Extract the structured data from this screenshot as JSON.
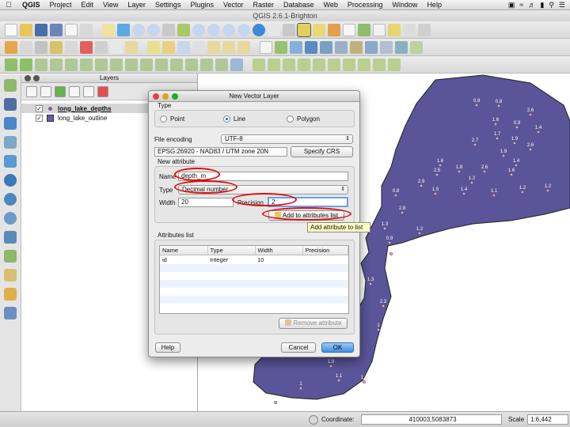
{
  "menubar": {
    "app": "QGIS",
    "items": [
      "Project",
      "Edit",
      "View",
      "Layer",
      "Settings",
      "Plugins",
      "Vector",
      "Raster",
      "Database",
      "Web",
      "Processing",
      "Window",
      "Help"
    ]
  },
  "window_title": "QGIS 2.6.1-Brighton",
  "layers_panel": {
    "title": "Layers",
    "layers": [
      {
        "name": "long_lake_depths",
        "checked": true,
        "bold": true,
        "symbol_color": "#7a5fb0"
      },
      {
        "name": "long_lake_outline",
        "checked": true,
        "bold": false,
        "symbol_color": "#6a5aa8"
      }
    ]
  },
  "map": {
    "lake_color": "#5a5598",
    "depth_labels": [
      "0.9",
      "0.8",
      "2.6",
      "1.6",
      "0.9",
      "1.4",
      "1.7",
      "1.9",
      "2.6",
      "2.7",
      "1.9",
      "1.4",
      "1.6",
      "1.8",
      "2.6",
      "1.6",
      "2.5",
      "1.2",
      "2.9",
      "1.5",
      "1.4",
      "1.1",
      "1.2",
      "1.2",
      "0.8",
      "2.8",
      "1.3",
      "1.2",
      "0.9",
      "2.6",
      "1.3",
      "2.3",
      "1",
      "1.9",
      "1.1",
      "1.1",
      "1",
      "0.9"
    ]
  },
  "dialog": {
    "title": "New Vector Layer",
    "type_group": "Type",
    "type_options": [
      {
        "label": "Point",
        "selected": false
      },
      {
        "label": "Line",
        "selected": true
      },
      {
        "label": "Polygon",
        "selected": false
      }
    ],
    "file_encoding_label": "File encoding",
    "file_encoding_value": "UTF-8",
    "crs_value": "EPSG:26920 - NAD83 / UTM zone 20N",
    "specify_crs_button": "Specify CRS",
    "new_attribute_group": "New attribute",
    "name_label": "Name",
    "name_value": "depth_m",
    "type_label": "Type",
    "type_value": "Decimal number",
    "width_label": "Width",
    "width_value": "20",
    "precision_label": "Precision",
    "precision_value": "2",
    "add_button": "Add to attributes list",
    "attributes_group": "Attributes list",
    "columns": [
      "Name",
      "Type",
      "Width",
      "Precision"
    ],
    "rows": [
      [
        "id",
        "Integer",
        "10",
        ""
      ]
    ],
    "remove_button": "Remove attribute",
    "help_button": "Help",
    "cancel_button": "Cancel",
    "ok_button": "OK"
  },
  "tooltip": "Add attribute to list",
  "statusbar": {
    "coordinate_label": "Coordinate:",
    "coordinate_value": "410003,5083873",
    "scale_label": "Scale",
    "scale_value": "1:6,442"
  }
}
